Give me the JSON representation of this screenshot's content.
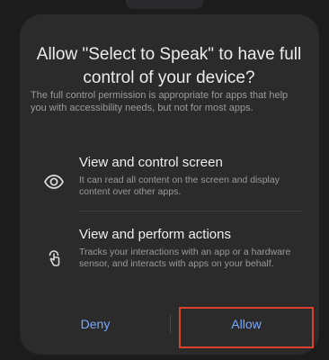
{
  "dialog": {
    "title": "Allow \"Select to Speak\" to have full control of your device?",
    "description": "The full control permission is appropriate for apps that help you with accessibility needs, but not for most apps.",
    "permissions": [
      {
        "icon": "eye-icon",
        "title": "View and control screen",
        "description": "It can read all content on the screen and display content over other apps."
      },
      {
        "icon": "touch-gesture-icon",
        "title": "View and perform actions",
        "description": "Tracks your interactions with an app or a hardware sensor, and interacts with apps on your behalf."
      }
    ],
    "buttons": {
      "deny": "Deny",
      "allow": "Allow"
    }
  },
  "colors": {
    "dialog_bg": "#2b2b2b",
    "accent": "#7aa7ff",
    "highlight": "#d7442b"
  }
}
